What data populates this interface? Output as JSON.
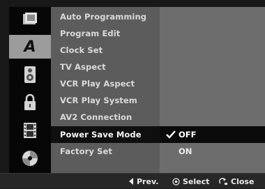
{
  "rail": {
    "icons": [
      {
        "name": "disc-setup-icon"
      },
      {
        "name": "language-icon",
        "glyph": "A",
        "active": true
      },
      {
        "name": "speaker-icon"
      },
      {
        "name": "lock-icon"
      },
      {
        "name": "film-icon"
      },
      {
        "name": "disc-icon"
      }
    ]
  },
  "menu": {
    "items": [
      "Auto Programming",
      "Program Edit",
      "Clock Set",
      "TV Aspect",
      "VCR Play Aspect",
      "VCR Play System",
      "AV2 Connection",
      "Power Save Mode",
      "Factory Set"
    ],
    "selected_index": 7
  },
  "options": {
    "items": [
      "OFF",
      "ON"
    ],
    "checked": "OFF"
  },
  "bottom_bar": {
    "prev_label": "Prev.",
    "select_label": "Select",
    "close_label": "Close"
  }
}
